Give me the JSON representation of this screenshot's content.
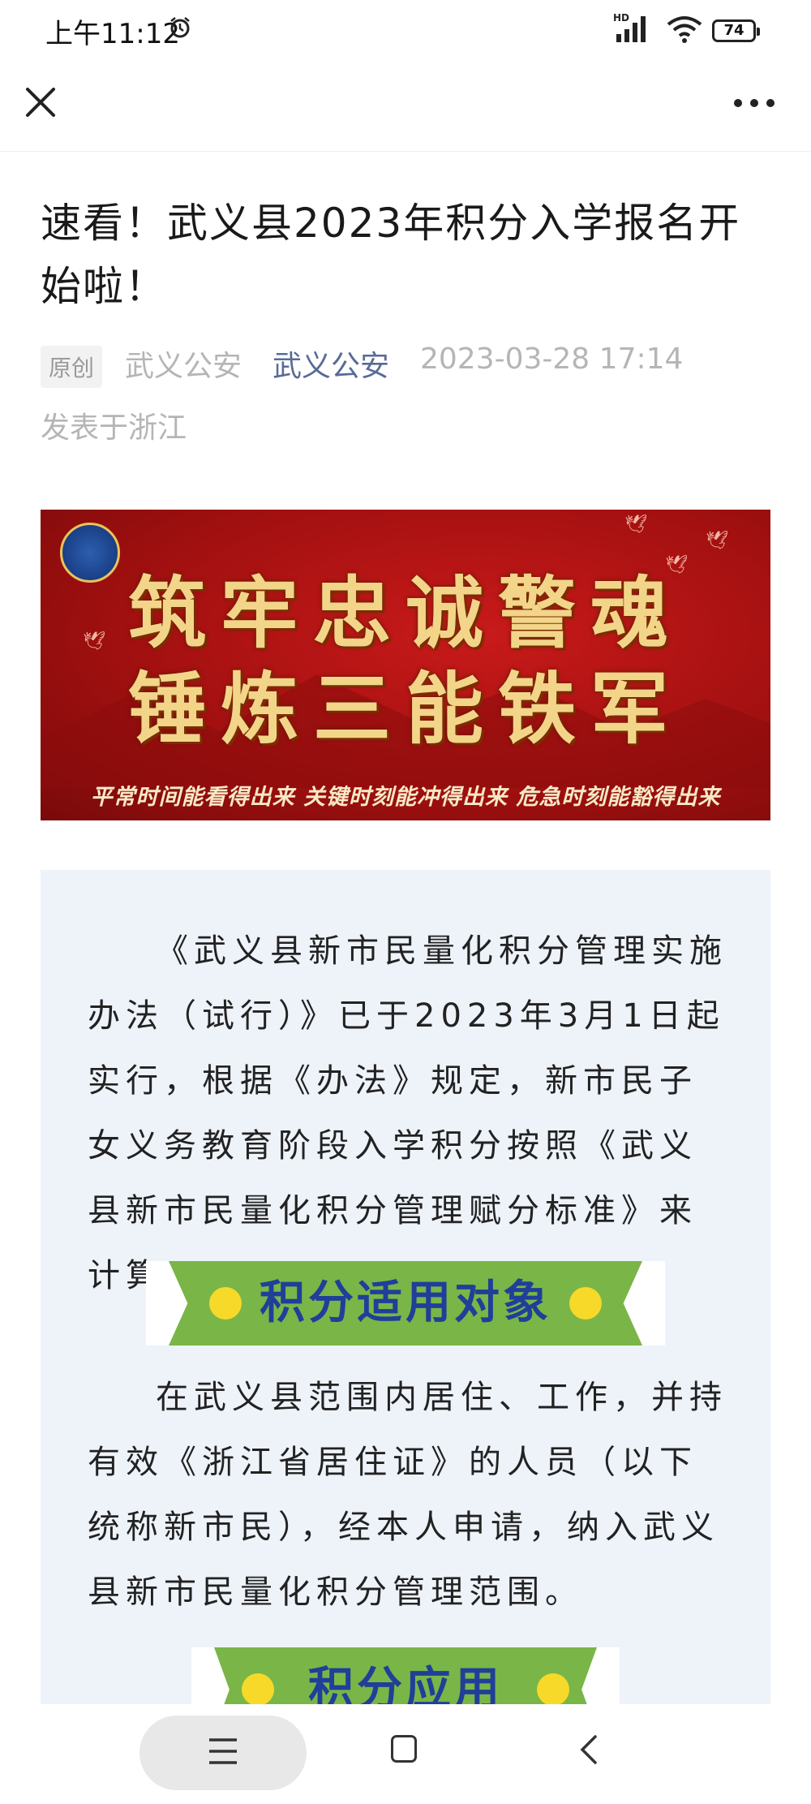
{
  "status_bar": {
    "time": "上午11:12",
    "battery": "74",
    "network": "HD"
  },
  "nav": {
    "close_icon": "close-icon",
    "more_icon": "more-icon"
  },
  "article": {
    "title": "速看！武义县2023年积分入学报名开始啦！",
    "original_tag": "原创",
    "author": "武义公安",
    "account": "武义公安",
    "datetime": "2023-03-28 17:14",
    "location": "发表于浙江"
  },
  "banner": {
    "line1": "筑牢忠诚警魂",
    "line2": "锤炼三能铁军",
    "slogan": "平常时间能看得出来  关键时刻能冲得出来  危急时刻能豁得出来"
  },
  "content": {
    "paragraph1": "《武义县新市民量化积分管理实施办法（试行）》已于2023年3月1日起实行，根据《办法》规定，新市民子女义务教育阶段入学积分按照《武义县新市民量化积分管理赋分标准》来计算。",
    "heading1": "积分适用对象",
    "paragraph2": "在武义县范围内居住、工作，并持有效《浙江省居住证》的人员（以下统称新市民），经本人申请，纳入武义县新市民量化积分管理范围。",
    "heading2": "积分应用"
  },
  "colors": {
    "account_link": "#576b95",
    "ribbon_green": "#7ab547",
    "ribbon_text": "#1f3f99",
    "banner_red": "#a31010",
    "panel_bg": "#eef3fa"
  }
}
